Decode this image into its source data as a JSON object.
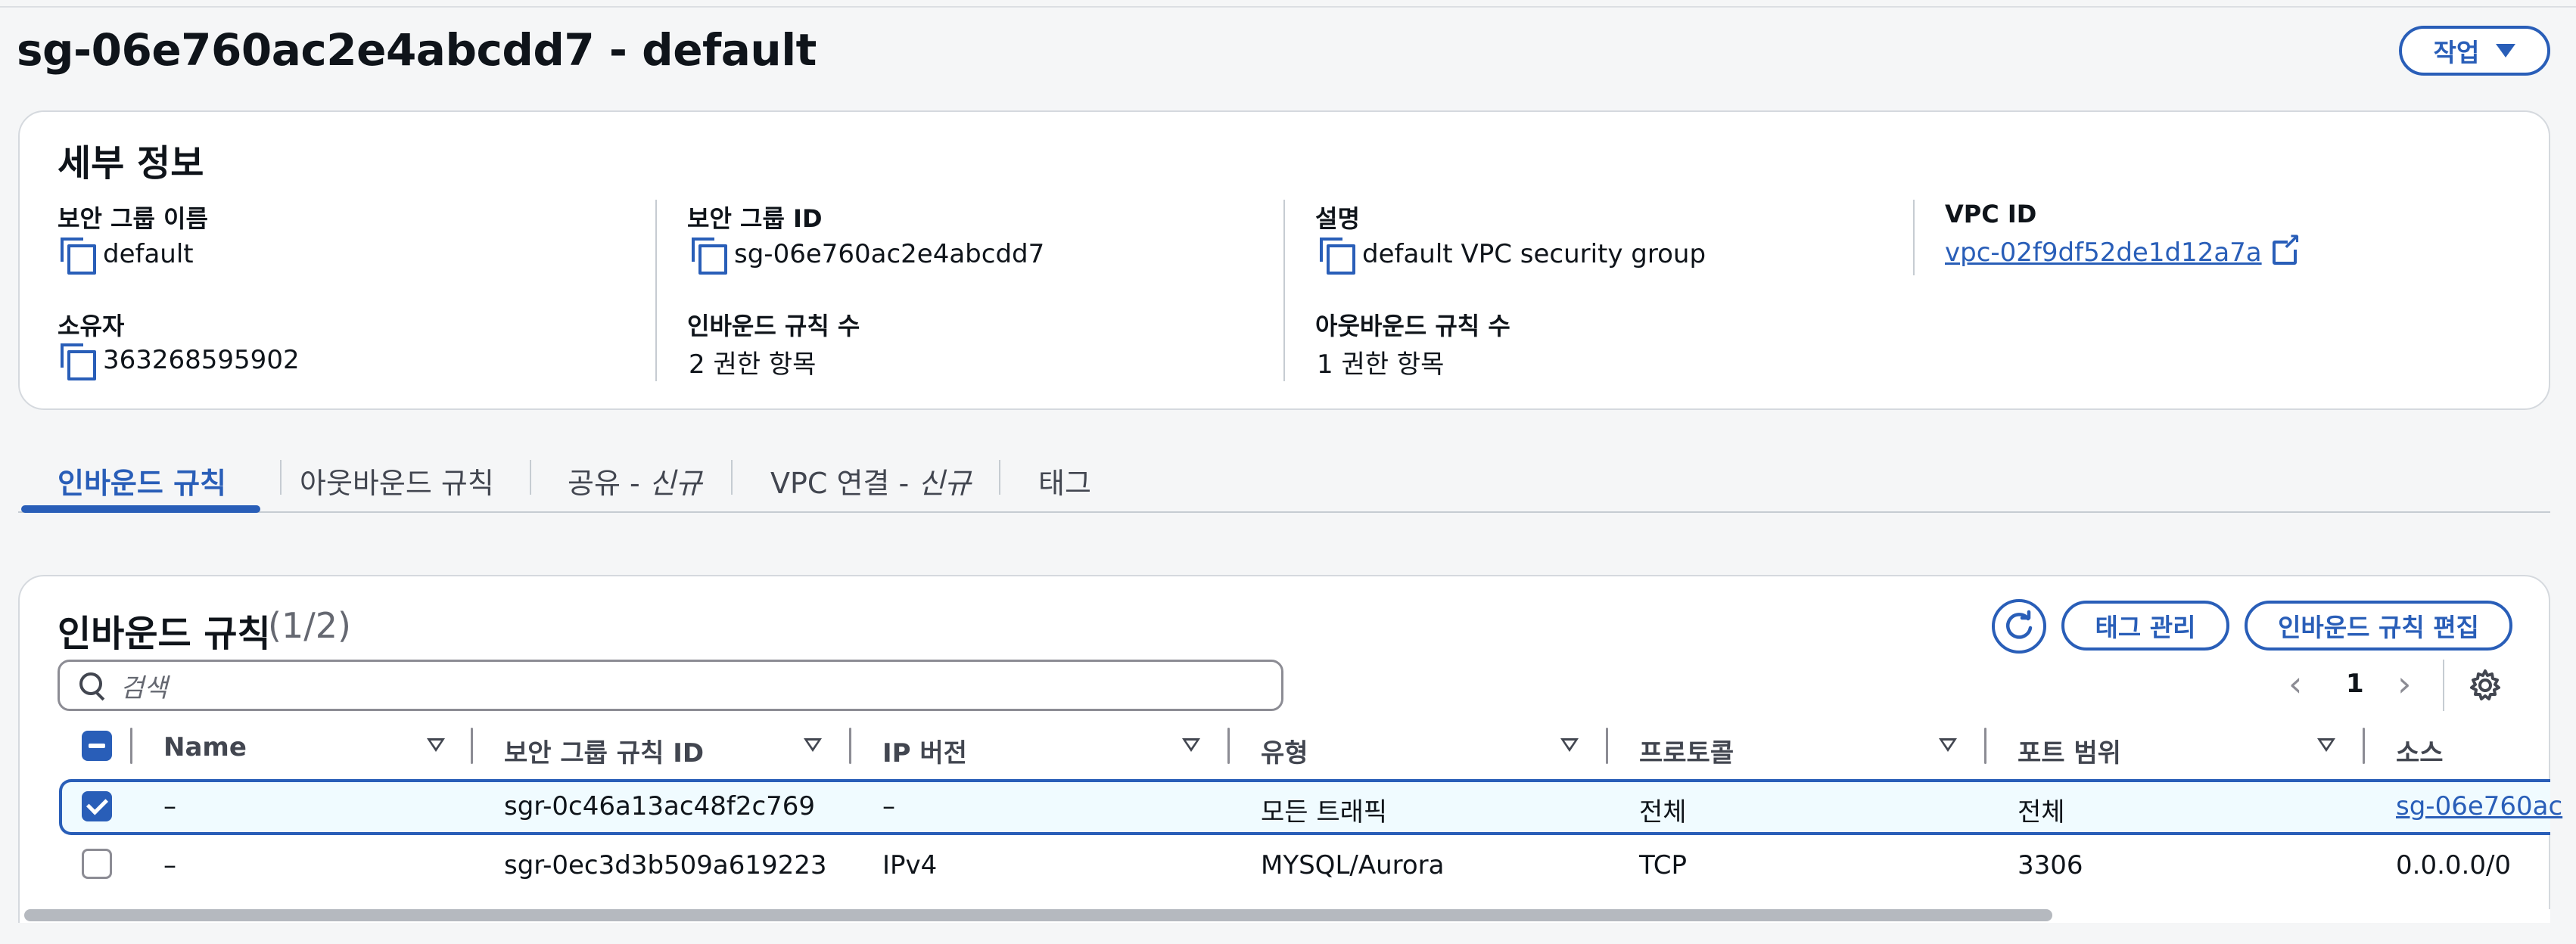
{
  "page": {
    "title": "sg-06e760ac2e4abcdd7 - default",
    "actions_label": "작업"
  },
  "details": {
    "heading": "세부 정보",
    "fields": {
      "name_label": "보안 그룹 이름",
      "name_value": "default",
      "sg_id_label": "보안 그룹 ID",
      "sg_id_value": "sg-06e760ac2e4abcdd7",
      "desc_label": "설명",
      "desc_value": "default VPC security group",
      "vpc_label": "VPC ID",
      "vpc_value": "vpc-02f9df52de1d12a7a",
      "owner_label": "소유자",
      "owner_value": "363268595902",
      "inbound_count_label": "인바운드 규칙 수",
      "inbound_count_value": "2 권한 항목",
      "outbound_count_label": "아웃바운드 규칙 수",
      "outbound_count_value": "1 권한 항목"
    }
  },
  "tabs": [
    {
      "label": "인바운드 규칙",
      "suffix": "",
      "active": true
    },
    {
      "label": "아웃바운드 규칙",
      "suffix": "",
      "active": false
    },
    {
      "label": "공유 - ",
      "suffix": "신규",
      "active": false
    },
    {
      "label": "VPC 연결 - ",
      "suffix": "신규",
      "active": false
    },
    {
      "label": "태그",
      "suffix": "",
      "active": false
    }
  ],
  "rules_panel": {
    "title": "인바운드 규칙",
    "count": "(1/2)",
    "manage_tags_label": "태그 관리",
    "edit_rules_label": "인바운드 규칙 편집",
    "search_placeholder": "검색",
    "page_number": "1",
    "columns": [
      "Name",
      "보안 그룹 규칙 ID",
      "IP 버전",
      "유형",
      "프로토콜",
      "포트 범위",
      "소스"
    ],
    "rows": [
      {
        "selected": true,
        "cells": [
          "–",
          "sgr-0c46a13ac48f2c769",
          "–",
          "모든 트래픽",
          "전체",
          "전체",
          "sg-06e760ac"
        ]
      },
      {
        "selected": false,
        "cells": [
          "–",
          "sgr-0ec3d3b509a619223",
          "IPv4",
          "MYSQL/Aurora",
          "TCP",
          "3306",
          "0.0.0.0/0"
        ]
      }
    ]
  },
  "colors": {
    "accent": "#295eb8",
    "text": "#0f141a",
    "muted": "#656871",
    "selected_row_bg": "#f0fbff",
    "border": "#d5d9de"
  }
}
